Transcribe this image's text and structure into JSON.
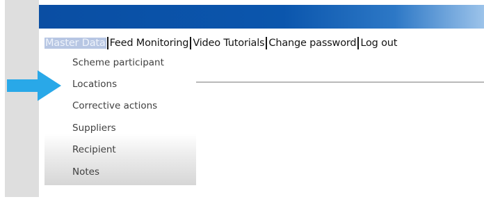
{
  "header": {
    "accent_color": "#0a4ea3"
  },
  "nav": {
    "items": [
      {
        "label": "Master Data",
        "active": true
      },
      {
        "label": "Feed Monitoring",
        "active": false
      },
      {
        "label": "Video Tutorials",
        "active": false
      },
      {
        "label": "Change password",
        "active": false
      },
      {
        "label": "Log out",
        "active": false
      }
    ]
  },
  "dropdown": {
    "items": [
      {
        "label": "Scheme participant"
      },
      {
        "label": "Locations"
      },
      {
        "label": "Corrective actions"
      },
      {
        "label": "Suppliers"
      },
      {
        "label": "Recipient"
      },
      {
        "label": "Notes"
      }
    ]
  },
  "annotation": {
    "icon": "right-arrow-icon",
    "color": "#29a8e8"
  }
}
